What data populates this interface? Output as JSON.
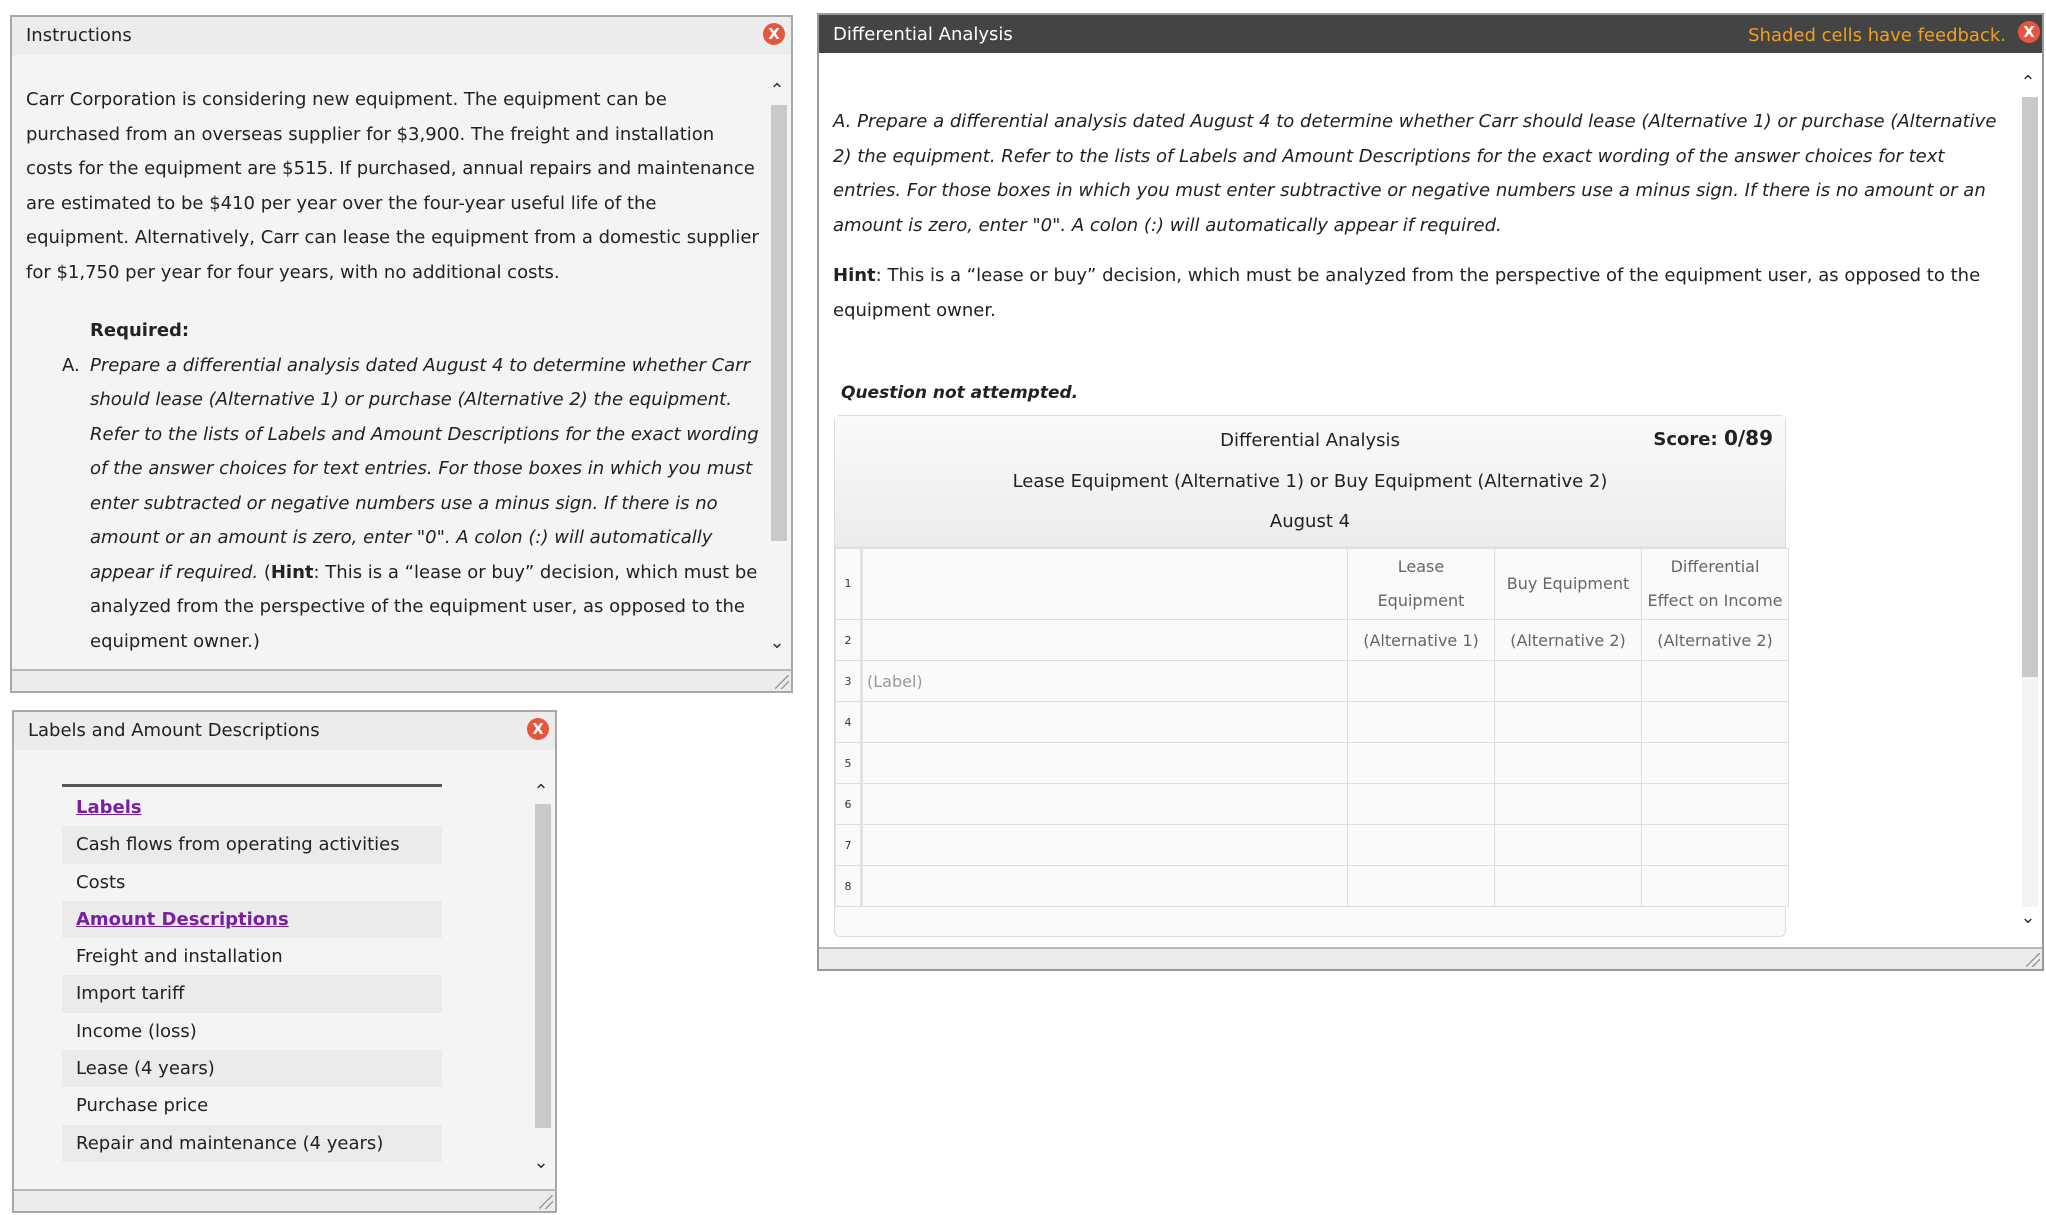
{
  "instructions_panel": {
    "title": "Instructions",
    "paragraph": "Carr Corporation is considering new equipment. The equipment can be purchased from an overseas supplier for $3,900. The freight and installation costs for the equipment are $515. If purchased, annual repairs and maintenance are estimated to be $410 per year over the four-year useful life of the equipment. Alternatively, Carr can lease the equipment from a domestic supplier for $1,750 per year for four years, with no additional costs.",
    "required_label": "Required:",
    "requirement_letter": "A.",
    "requirement_italic": "Prepare a differential analysis dated August 4 to determine whether Carr should lease (Alternative 1) or purchase (Alternative 2) the equipment. Refer to the lists of Labels and Amount Descriptions for the exact wording of the answer choices for text entries. For those boxes in which you must enter subtracted or negative numbers use a minus sign. If there is no amount or an amount is zero, enter \"0\". A colon (:) will automatically appear if required.",
    "hint_open": " (",
    "hint_label": "Hint",
    "hint_text": ": This is a “lease or buy” decision, which must be analyzed from the perspective of the equipment user, as opposed to the equipment owner.)",
    "close_icon": "X"
  },
  "labels_panel": {
    "title": "Labels and Amount Descriptions",
    "close_icon": "X",
    "rows": [
      {
        "text": "Labels",
        "type": "heading"
      },
      {
        "text": "Cash flows from operating activities",
        "type": "item"
      },
      {
        "text": "Costs",
        "type": "item"
      },
      {
        "text": "Amount Descriptions",
        "type": "heading"
      },
      {
        "text": "Freight and installation",
        "type": "item"
      },
      {
        "text": "Import tariff",
        "type": "item"
      },
      {
        "text": "Income (loss)",
        "type": "item"
      },
      {
        "text": "Lease (4 years)",
        "type": "item"
      },
      {
        "text": "Purchase price",
        "type": "item"
      },
      {
        "text": "Repair and maintenance (4 years)",
        "type": "item"
      }
    ]
  },
  "diff_panel": {
    "title": "Differential Analysis",
    "feedback_note": "Shaded cells have feedback.",
    "close_icon": "X",
    "instruction": "A. Prepare a differential analysis dated August 4 to determine whether Carr should lease (Alternative 1) or purchase (Alternative 2) the equipment. Refer to the lists of Labels and Amount Descriptions for the exact wording of the answer choices for text entries. For those boxes in which you must enter subtractive or negative numbers use a minus sign. If there is no amount or an amount is zero, enter \"0\". A colon (:) will automatically appear if required.",
    "hint_label": "Hint",
    "hint_text": ": This is a “lease or buy” decision, which must be analyzed from the perspective of the equipment user, as opposed to the equipment owner.",
    "status": "Question not attempted.",
    "sheet": {
      "title": "Differential Analysis",
      "subtitle": "Lease Equipment (Alternative 1) or Buy Equipment (Alternative 2)",
      "date": "August 4",
      "score_label": "Score:",
      "score_value": "0/89",
      "columns": [
        {
          "line1": "Lease",
          "line2": "Equipment",
          "alt": "(Alternative 1)"
        },
        {
          "line1": "Buy Equipment",
          "line2": "",
          "alt": "(Alternative 2)"
        },
        {
          "line1": "Differential",
          "line2": "Effect on Income",
          "alt": "(Alternative 2)"
        }
      ],
      "row_numbers": [
        "1",
        "2",
        "3",
        "4",
        "5",
        "6",
        "7",
        "8"
      ],
      "label_placeholder": "(Label)"
    }
  }
}
